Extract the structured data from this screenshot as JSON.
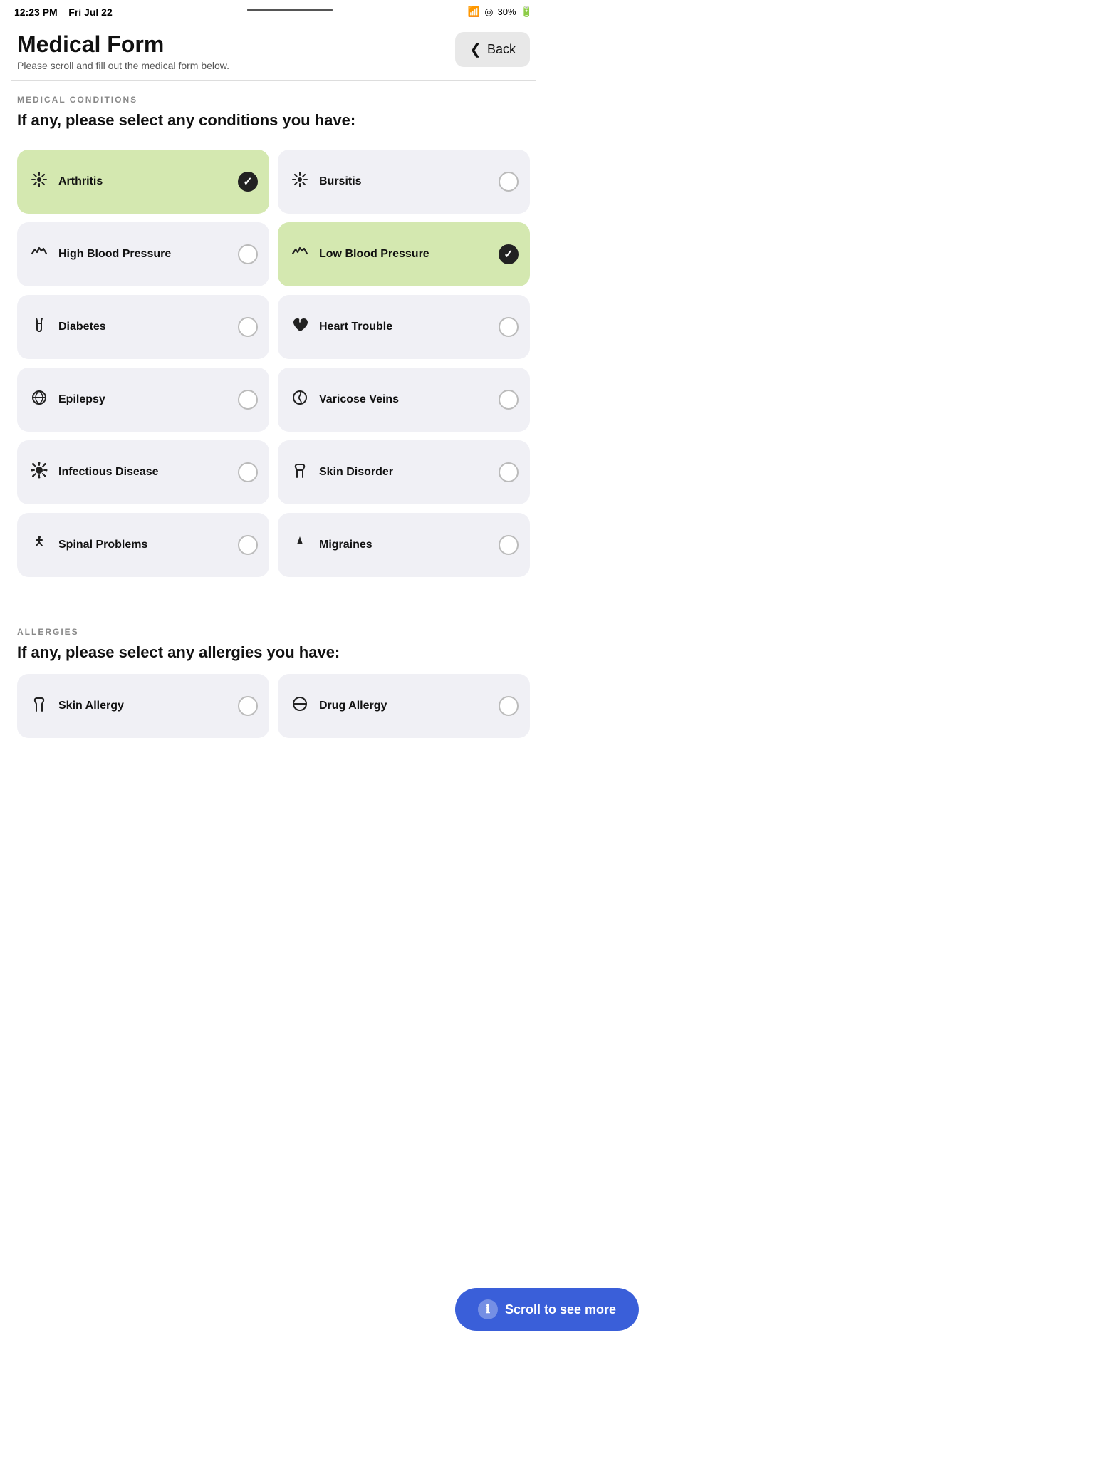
{
  "statusBar": {
    "time": "12:23 PM",
    "date": "Fri Jul 22",
    "battery": "30%",
    "wifi": "wifi",
    "location": "loc"
  },
  "header": {
    "title": "Medical Form",
    "subtitle": "Please scroll and fill out the medical form below.",
    "backLabel": "Back"
  },
  "medicalConditions": {
    "sectionLabel": "MEDICAL CONDITIONS",
    "question": "If any, please select any conditions you have:",
    "conditions": [
      {
        "id": "arthritis",
        "label": "Arthritis",
        "icon": "✳",
        "selected": true
      },
      {
        "id": "bursitis",
        "label": "Bursitis",
        "icon": "✳",
        "selected": false
      },
      {
        "id": "high-blood-pressure",
        "label": "High Blood Pressure",
        "icon": "💓",
        "selected": false
      },
      {
        "id": "low-blood-pressure",
        "label": "Low Blood Pressure",
        "icon": "💓",
        "selected": true
      },
      {
        "id": "diabetes",
        "label": "Diabetes",
        "icon": "🩺",
        "selected": false
      },
      {
        "id": "heart-trouble",
        "label": "Heart Trouble",
        "icon": "🖤",
        "selected": false
      },
      {
        "id": "epilepsy",
        "label": "Epilepsy",
        "icon": "👁",
        "selected": false
      },
      {
        "id": "varicose-veins",
        "label": "Varicose Veins",
        "icon": "⚕",
        "selected": false
      },
      {
        "id": "infectious-disease",
        "label": "Infectious Disease",
        "icon": "🦠",
        "selected": false
      },
      {
        "id": "skin-disorder",
        "label": "Skin Disorder",
        "icon": "✋",
        "selected": false
      },
      {
        "id": "spinal-problems",
        "label": "Spinal Problems",
        "icon": "🚶",
        "selected": false
      },
      {
        "id": "migraines",
        "label": "Migraines",
        "icon": "⚡",
        "selected": false
      }
    ]
  },
  "allergies": {
    "sectionLabel": "ALLERGIES",
    "question": "If any, please select any allergies you have:",
    "items": [
      {
        "id": "skin-allergy",
        "label": "Skin Allergy",
        "icon": "✋",
        "selected": false
      },
      {
        "id": "drug-allergy",
        "label": "Drug Allergy",
        "icon": "👁",
        "selected": false
      }
    ]
  },
  "toast": {
    "icon": "ℹ",
    "label": "Scroll to see more"
  },
  "icons": {
    "arthritis": "✳",
    "bursitis": "✳",
    "heartRate": "♥",
    "check": "✓",
    "chevronLeft": "❮",
    "info": "ℹ"
  }
}
